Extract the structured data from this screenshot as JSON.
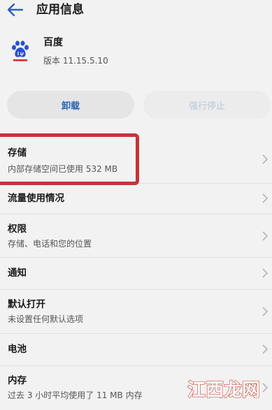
{
  "header": {
    "title": "应用信息",
    "back_icon": "arrow-left-icon"
  },
  "app": {
    "name": "百度",
    "version": "版本 11.15.5.10",
    "icon": "baidu-paw-icon"
  },
  "buttons": {
    "uninstall": "卸载",
    "force_stop": "强行停止"
  },
  "items": [
    {
      "title": "存储",
      "subtitle": "内部存储空间已使用 532 MB"
    },
    {
      "title": "流量使用情况",
      "subtitle": ""
    },
    {
      "title": "权限",
      "subtitle": "存储、电话和您的位置"
    },
    {
      "title": "通知",
      "subtitle": ""
    },
    {
      "title": "默认打开",
      "subtitle": "未设置任何默认选项"
    },
    {
      "title": "电池",
      "subtitle": ""
    },
    {
      "title": "内存",
      "subtitle": "过去 3 小时平均使用了 11 MB 内存"
    }
  ],
  "watermark": "江西龙网",
  "colors": {
    "accent": "#2a63b8",
    "highlight": "#c7333a",
    "background": "#f2f2f2"
  }
}
